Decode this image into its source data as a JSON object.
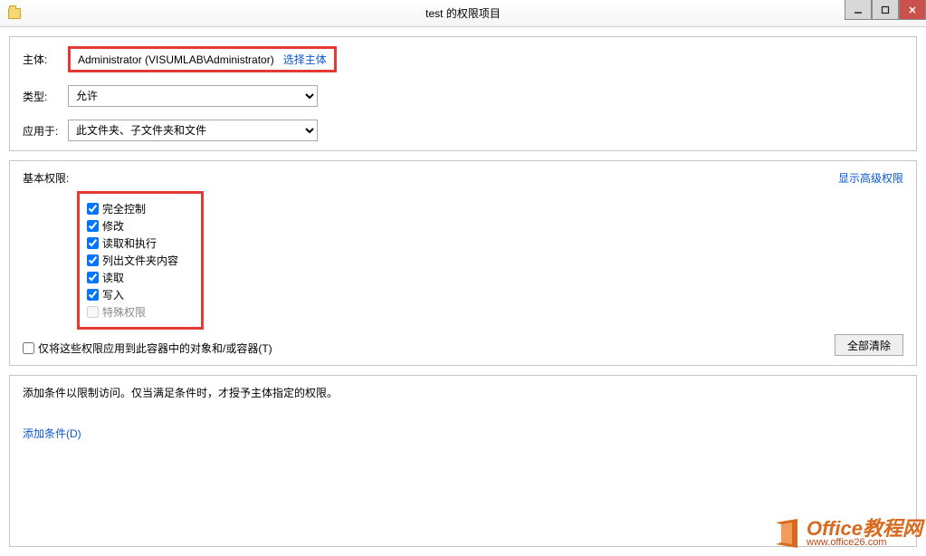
{
  "titlebar": {
    "title": "test 的权限项目"
  },
  "principal": {
    "label": "主体:",
    "name": "Administrator (VISUMLAB\\Administrator)",
    "select_link": "选择主体"
  },
  "type": {
    "label": "类型:",
    "value": "允许"
  },
  "applies_to": {
    "label": "应用于:",
    "value": "此文件夹、子文件夹和文件"
  },
  "permissions": {
    "header": "基本权限:",
    "show_advanced": "显示高级权限",
    "items": [
      {
        "label": "完全控制",
        "checked": true
      },
      {
        "label": "修改",
        "checked": true
      },
      {
        "label": "读取和执行",
        "checked": true
      },
      {
        "label": "列出文件夹内容",
        "checked": true
      },
      {
        "label": "读取",
        "checked": true
      },
      {
        "label": "写入",
        "checked": true
      },
      {
        "label": "特殊权限",
        "checked": false,
        "disabled": true
      }
    ],
    "only_apply": "仅将这些权限应用到此容器中的对象和/或容器(T)",
    "clear_all": "全部清除"
  },
  "conditions": {
    "text": "添加条件以限制访问。仅当满足条件时，才授予主体指定的权限。",
    "add_link": "添加条件(D)"
  },
  "watermark": {
    "main": "Office教程网",
    "sub": "www.office26.com"
  }
}
